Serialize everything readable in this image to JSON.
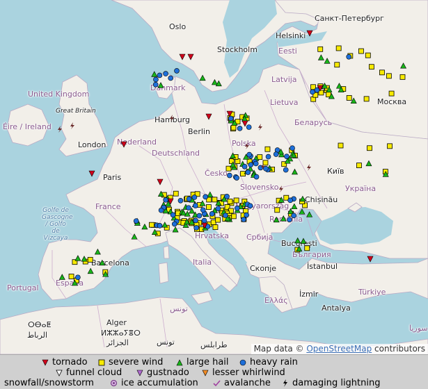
{
  "places": [
    {
      "id": "oslo",
      "text": "Oslo",
      "kind": "city"
    },
    {
      "id": "stockholm",
      "text": "Stockholm",
      "kind": "city"
    },
    {
      "id": "helsinki",
      "text": "Helsinki",
      "kind": "city"
    },
    {
      "id": "spb",
      "text": "Санкт-Петербург",
      "kind": "city"
    },
    {
      "id": "eesti",
      "text": "Eesti",
      "kind": "country"
    },
    {
      "id": "latvija",
      "text": "Latvija",
      "kind": "country"
    },
    {
      "id": "lietuva",
      "text": "Lietuva",
      "kind": "country"
    },
    {
      "id": "danmark",
      "text": "Danmark",
      "kind": "country"
    },
    {
      "id": "uk",
      "text": "United Kingdom",
      "kind": "country"
    },
    {
      "id": "gb",
      "text": "Great Britain",
      "kind": "island"
    },
    {
      "id": "ireland",
      "text": "Éire / Ireland",
      "kind": "country"
    },
    {
      "id": "london",
      "text": "London",
      "kind": "city"
    },
    {
      "id": "hamburg",
      "text": "Hamburg",
      "kind": "city"
    },
    {
      "id": "berlin",
      "text": "Berlin",
      "kind": "city"
    },
    {
      "id": "nederland",
      "text": "Nederland",
      "kind": "country"
    },
    {
      "id": "deutschland",
      "text": "Deutschland",
      "kind": "country"
    },
    {
      "id": "polska",
      "text": "Polska",
      "kind": "country"
    },
    {
      "id": "belarus",
      "text": "Беларусь",
      "kind": "country"
    },
    {
      "id": "moskva",
      "text": "Москва",
      "kind": "city"
    },
    {
      "id": "kyiv",
      "text": "Київ",
      "kind": "city"
    },
    {
      "id": "ukraina",
      "text": "Україна",
      "kind": "country"
    },
    {
      "id": "paris",
      "text": "Paris",
      "kind": "city"
    },
    {
      "id": "france",
      "text": "France",
      "kind": "country"
    },
    {
      "id": "cesko",
      "text": "Česko",
      "kind": "country"
    },
    {
      "id": "slovensko",
      "text": "Slovensko",
      "kind": "country"
    },
    {
      "id": "magyar",
      "text": "Magyarország",
      "kind": "country"
    },
    {
      "id": "chisinau",
      "text": "Chișinău",
      "kind": "city"
    },
    {
      "id": "romania",
      "text": "România",
      "kind": "country"
    },
    {
      "id": "hrvatska",
      "text": "Hrvatska",
      "kind": "country"
    },
    {
      "id": "srbija",
      "text": "Србија",
      "kind": "country"
    },
    {
      "id": "bucuresti",
      "text": "București",
      "kind": "city"
    },
    {
      "id": "bulgaria",
      "text": "България",
      "kind": "country"
    },
    {
      "id": "italia",
      "text": "Italia",
      "kind": "country"
    },
    {
      "id": "skopje",
      "text": "Скопје",
      "kind": "city"
    },
    {
      "id": "istanbul",
      "text": "İstanbul",
      "kind": "city"
    },
    {
      "id": "barcelona",
      "text": "Barcelona",
      "kind": "city"
    },
    {
      "id": "espana",
      "text": "España",
      "kind": "country"
    },
    {
      "id": "portugal",
      "text": "Portugal",
      "kind": "country"
    },
    {
      "id": "ellas",
      "text": "Ελλάς",
      "kind": "country"
    },
    {
      "id": "izmir",
      "text": "İzmir",
      "kind": "city"
    },
    {
      "id": "turkiye",
      "text": "Türkiye",
      "kind": "country"
    },
    {
      "id": "antalya",
      "text": "Antalya",
      "kind": "city"
    },
    {
      "id": "suriya",
      "text": "سوريا",
      "kind": "country"
    },
    {
      "id": "tunis",
      "text": "تونس",
      "kind": "country"
    },
    {
      "id": "alger",
      "text": "Alger",
      "kind": "city"
    },
    {
      "id": "alger_tif",
      "text": "ⵍⵣⵣⴰⵢⴻⵔ",
      "kind": "city"
    },
    {
      "id": "alger_ar",
      "text": "الجزائر",
      "kind": "city"
    },
    {
      "id": "rabat",
      "text": "ⵔⴱⴰⵟ",
      "kind": "city"
    },
    {
      "id": "rabat_ar",
      "text": "الرباط",
      "kind": "city"
    },
    {
      "id": "tarabulus",
      "text": "طرابلس",
      "kind": "city"
    },
    {
      "id": "tunis2",
      "text": "تونس",
      "kind": "city"
    },
    {
      "id": "gascogne",
      "text": "Golfe de Gascogne / Golfo de Vizcaya",
      "kind": "sea"
    }
  ],
  "attribution": {
    "prefix": "Map data © ",
    "link": "OpenStreetMap",
    "suffix": " contributors"
  },
  "legend": [
    {
      "id": "tornado",
      "label": "tornado",
      "icon": "red-down-triangle",
      "color": "#d0021b"
    },
    {
      "id": "severe-wind",
      "label": "severe wind",
      "icon": "yellow-square",
      "color": "#f7ea00"
    },
    {
      "id": "large-hail",
      "label": "large hail",
      "icon": "green-triangle",
      "color": "#19b519"
    },
    {
      "id": "heavy-rain",
      "label": "heavy rain",
      "icon": "blue-circle",
      "color": "#1e6fd9"
    },
    {
      "id": "funnel-cloud",
      "label": "funnel cloud",
      "icon": "outline-down-triangle",
      "color": "#ffffff"
    },
    {
      "id": "gustnado",
      "label": "gustnado",
      "icon": "purple-down-triangle",
      "color": "#b06ad0"
    },
    {
      "id": "lesser-whirlwind",
      "label": "lesser whirlwind",
      "icon": "orange-down-triangle",
      "color": "#f08a24"
    },
    {
      "id": "snowfall",
      "label": "snowfall/snowstorm",
      "icon": "snowflake",
      "color": "#5aa7e0"
    },
    {
      "id": "ice-accumulation",
      "label": "ice accumulation",
      "icon": "ice-ring",
      "color": "#a060b0"
    },
    {
      "id": "avalanche",
      "label": "avalanche",
      "icon": "avalanche-check",
      "color": "#a040a0"
    },
    {
      "id": "damaging-lightning",
      "label": "damaging lightning",
      "icon": "lightning-bolt",
      "color": "#000000"
    }
  ]
}
